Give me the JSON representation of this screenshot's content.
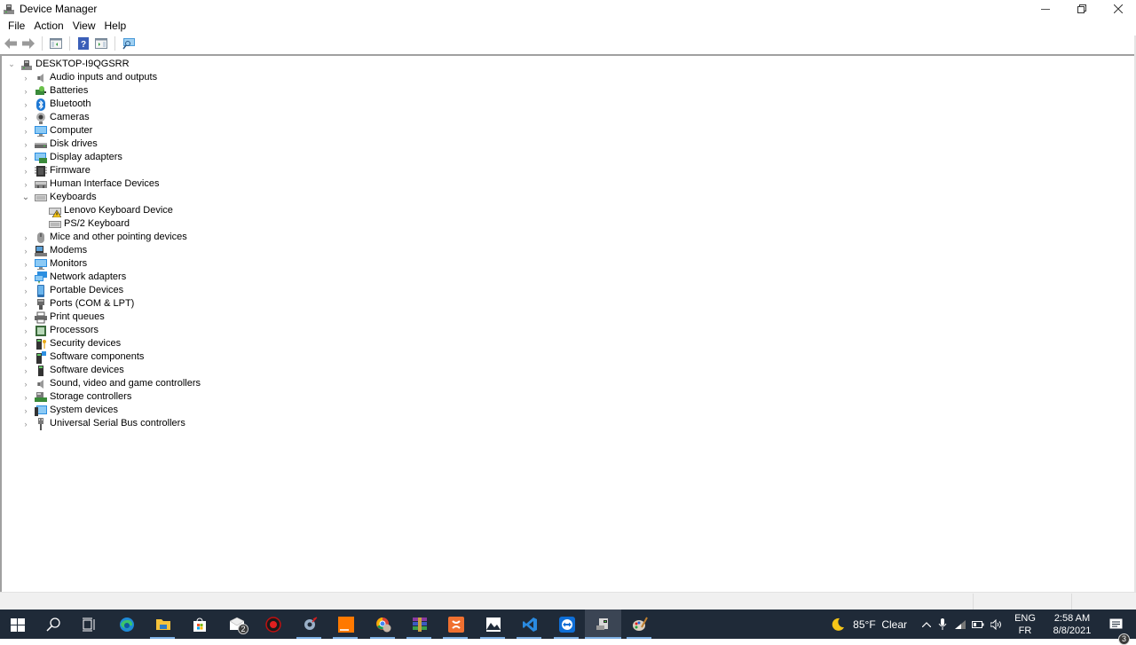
{
  "window": {
    "title": "Device Manager",
    "controls": {
      "minimize": "—",
      "restore": "❐",
      "close": "✕"
    }
  },
  "menu": [
    "File",
    "Action",
    "View",
    "Help"
  ],
  "toolbar": {
    "buttons": [
      "back-icon",
      "forward-icon",
      "show-hide-console-tree-icon",
      "help-icon",
      "properties-icon",
      "scan-hardware-icon"
    ]
  },
  "tree": {
    "root": {
      "label": "DESKTOP-I9QGSRR",
      "icon": "computer-icon",
      "expanded": true
    },
    "categories": [
      {
        "label": "Audio inputs and outputs",
        "icon": "speaker-icon",
        "expanded": false
      },
      {
        "label": "Batteries",
        "icon": "battery-icon",
        "expanded": false
      },
      {
        "label": "Bluetooth",
        "icon": "bluetooth-icon",
        "expanded": false
      },
      {
        "label": "Cameras",
        "icon": "camera-icon",
        "expanded": false
      },
      {
        "label": "Computer",
        "icon": "monitor-icon",
        "expanded": false
      },
      {
        "label": "Disk drives",
        "icon": "disk-drive-icon",
        "expanded": false
      },
      {
        "label": "Display adapters",
        "icon": "display-adapter-icon",
        "expanded": false
      },
      {
        "label": "Firmware",
        "icon": "firmware-icon",
        "expanded": false
      },
      {
        "label": "Human Interface Devices",
        "icon": "hid-icon",
        "expanded": false
      },
      {
        "label": "Keyboards",
        "icon": "keyboard-icon",
        "expanded": true,
        "children": [
          {
            "label": "Lenovo Keyboard Device",
            "icon": "keyboard-warning-icon",
            "warning": true
          },
          {
            "label": "PS/2 Keyboard",
            "icon": "keyboard-icon",
            "warning": false
          }
        ]
      },
      {
        "label": "Mice and other pointing devices",
        "icon": "mouse-icon",
        "expanded": false
      },
      {
        "label": "Modems",
        "icon": "modem-icon",
        "expanded": false
      },
      {
        "label": "Monitors",
        "icon": "monitor-icon",
        "expanded": false
      },
      {
        "label": "Network adapters",
        "icon": "network-adapter-icon",
        "expanded": false
      },
      {
        "label": "Portable Devices",
        "icon": "portable-device-icon",
        "expanded": false
      },
      {
        "label": "Ports (COM & LPT)",
        "icon": "port-icon",
        "expanded": false
      },
      {
        "label": "Print queues",
        "icon": "printer-icon",
        "expanded": false
      },
      {
        "label": "Processors",
        "icon": "processor-icon",
        "expanded": false
      },
      {
        "label": "Security devices",
        "icon": "security-device-icon",
        "expanded": false
      },
      {
        "label": "Software components",
        "icon": "software-component-icon",
        "expanded": false
      },
      {
        "label": "Software devices",
        "icon": "software-device-icon",
        "expanded": false
      },
      {
        "label": "Sound, video and game controllers",
        "icon": "speaker-icon",
        "expanded": false
      },
      {
        "label": "Storage controllers",
        "icon": "storage-controller-icon",
        "expanded": false
      },
      {
        "label": "System devices",
        "icon": "system-device-icon",
        "expanded": false
      },
      {
        "label": "Universal Serial Bus controllers",
        "icon": "usb-icon",
        "expanded": false
      }
    ]
  },
  "taskbar": {
    "apps": [
      {
        "name": "start",
        "icon": "windows-start-icon"
      },
      {
        "name": "search",
        "icon": "search-icon"
      },
      {
        "name": "task-view",
        "icon": "task-view-icon"
      },
      {
        "name": "edge",
        "icon": "edge-browser-icon"
      },
      {
        "name": "file-explorer",
        "icon": "folder-icon",
        "running": true
      },
      {
        "name": "microsoft-store",
        "icon": "store-icon"
      },
      {
        "name": "mail",
        "icon": "mail-icon",
        "badge": "2"
      },
      {
        "name": "app-red",
        "icon": "red-circle-app-icon"
      },
      {
        "name": "settings-tool",
        "icon": "gear-tool-icon",
        "running": true
      },
      {
        "name": "orange",
        "icon": "orange-app-icon",
        "running": true
      },
      {
        "name": "chrome",
        "icon": "chrome-icon",
        "running": true
      },
      {
        "name": "winrar",
        "icon": "winrar-icon",
        "running": true
      },
      {
        "name": "xampp",
        "icon": "xampp-icon",
        "running": true
      },
      {
        "name": "photos",
        "icon": "photos-icon",
        "running": true
      },
      {
        "name": "vscode",
        "icon": "vscode-icon",
        "running": true
      },
      {
        "name": "teamviewer",
        "icon": "teamviewer-icon",
        "running": true
      },
      {
        "name": "device-manager",
        "icon": "device-manager-icon",
        "running": true,
        "active": true
      },
      {
        "name": "paint",
        "icon": "paint-icon",
        "running": true
      }
    ],
    "weather": {
      "icon": "moon-icon",
      "text": "85°F  Clear"
    },
    "tray": {
      "chevron": "^",
      "language_top": "ENG",
      "language_bottom": "FR",
      "time": "2:58 AM",
      "date": "8/8/2021",
      "notifications": "3"
    }
  }
}
